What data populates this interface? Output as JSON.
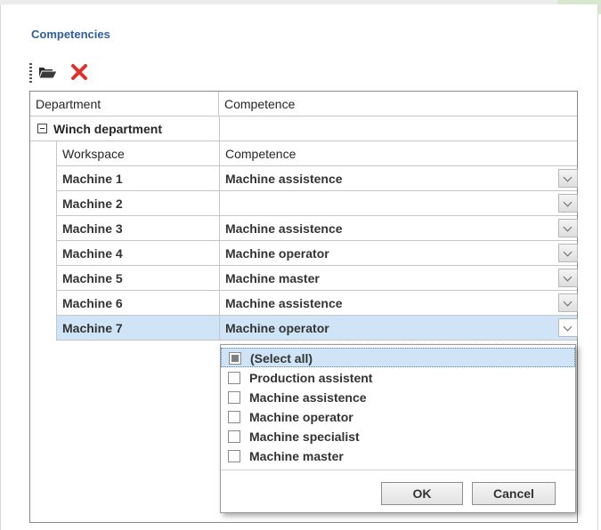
{
  "panel": {
    "title": "Competencies"
  },
  "toolbar": {
    "icons": {
      "open": "folder-open-icon",
      "delete": "delete-x-icon"
    },
    "colors": {
      "folder": "#2b2b2b",
      "delete": "#e0302c"
    }
  },
  "grid": {
    "columns": {
      "department": "Department",
      "competence": "Competence"
    },
    "group": {
      "label": "Winch department",
      "expanded": true
    },
    "sub_columns": {
      "workspace": "Workspace",
      "competence": "Competence"
    },
    "rows": [
      {
        "workspace": "Machine 1",
        "competence": "Machine assistence"
      },
      {
        "workspace": "Machine 2",
        "competence": ""
      },
      {
        "workspace": "Machine 3",
        "competence": "Machine assistence"
      },
      {
        "workspace": "Machine 4",
        "competence": "Machine operator"
      },
      {
        "workspace": "Machine 5",
        "competence": "Machine master"
      },
      {
        "workspace": "Machine 6",
        "competence": "Machine assistence"
      },
      {
        "workspace": "Machine 7",
        "competence": "Machine operator"
      }
    ],
    "selected_row": "Machine 7"
  },
  "dropdown": {
    "options": [
      {
        "label": "(Select all)",
        "state": "partial"
      },
      {
        "label": "Production assistent",
        "state": "unchecked"
      },
      {
        "label": "Machine assistence",
        "state": "unchecked"
      },
      {
        "label": "Machine operator",
        "state": "unchecked"
      },
      {
        "label": "Machine specialist",
        "state": "unchecked"
      },
      {
        "label": "Machine master",
        "state": "unchecked"
      }
    ],
    "ok_label": "OK",
    "cancel_label": "Cancel"
  },
  "colors": {
    "title": "#2e5f9e",
    "selection": "#cfe4f7",
    "accent_corner": "#d7e8cf"
  }
}
